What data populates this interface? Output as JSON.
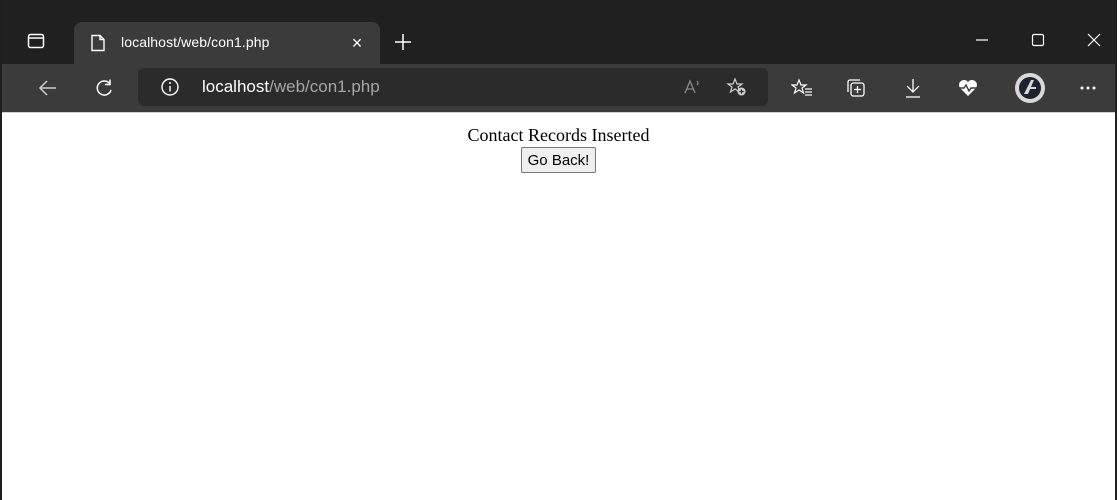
{
  "browser": {
    "tab": {
      "title": "localhost/web/con1.php",
      "close_symbol": "×",
      "icon": "page-icon"
    },
    "new_tab_icon": "plus-icon",
    "window_controls": [
      "minimize-icon",
      "maximize-icon",
      "close-icon"
    ],
    "address": {
      "host": "localhost",
      "path": "/web/con1.php",
      "info_icon": "info-icon"
    },
    "toolbar_icons": [
      "back-arrow-icon",
      "refresh-icon",
      "read-aloud-icon",
      "add-favorite-icon",
      "favorites-icon",
      "collections-icon",
      "downloads-icon",
      "browser-essentials-icon",
      "profile-avatar",
      "more-icon"
    ],
    "colors": {
      "tabstrip": "#202020",
      "toolbar": "#3b3b3b",
      "addressbar": "#2b2b2b"
    }
  },
  "page": {
    "message": "Contact Records Inserted",
    "button_label": "Go Back!"
  }
}
